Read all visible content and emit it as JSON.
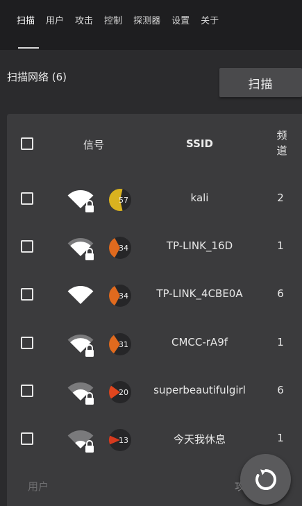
{
  "tabs": [
    {
      "label": "扫描",
      "active": true
    },
    {
      "label": "用户"
    },
    {
      "label": "攻击"
    },
    {
      "label": "控制"
    },
    {
      "label": "探测器"
    },
    {
      "label": "设置"
    },
    {
      "label": "关于"
    }
  ],
  "section": {
    "title": "扫描网络 (6)",
    "scan_button": "扫描"
  },
  "table": {
    "headers": {
      "signal": "信号",
      "ssid": "SSID",
      "channel_line1": "频",
      "channel_line2": "道"
    },
    "rows": [
      {
        "ssid": "kali",
        "channel": "2",
        "signal": "57",
        "wifi_level": 4,
        "locked": true,
        "badge_color": "#d9b21f",
        "badge_fill": 0.57
      },
      {
        "ssid": "TP-LINK_16D",
        "channel": "1",
        "signal": "34",
        "wifi_level": 3,
        "locked": true,
        "badge_color": "#e06a1e",
        "badge_fill": 0.34
      },
      {
        "ssid": "TP-LINK_4CBE0A",
        "channel": "6",
        "signal": "34",
        "wifi_level": 4,
        "locked": false,
        "badge_color": "#e06a1e",
        "badge_fill": 0.34
      },
      {
        "ssid": "CMCC-rA9f",
        "channel": "1",
        "signal": "31",
        "wifi_level": 3,
        "locked": true,
        "badge_color": "#e06a1e",
        "badge_fill": 0.31
      },
      {
        "ssid": "superbeautifulgirl",
        "channel": "6",
        "signal": "20",
        "wifi_level": 2,
        "locked": true,
        "badge_color": "#e0461e",
        "badge_fill": 0.2
      },
      {
        "ssid": "今天我休息",
        "channel": "1",
        "signal": "13",
        "wifi_level": 1,
        "locked": true,
        "badge_color": "#d63a1e",
        "badge_fill": 0.13
      }
    ]
  },
  "footer": {
    "left_label": "用户",
    "right_label": "攻"
  },
  "fab": {
    "icon": "refresh-icon"
  }
}
